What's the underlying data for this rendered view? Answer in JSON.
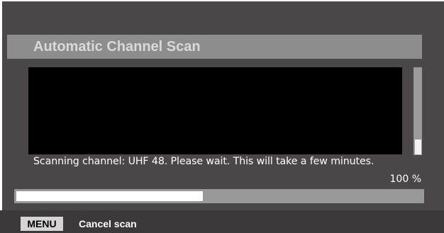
{
  "dialog": {
    "title": "Automatic Channel Scan",
    "status_message": "Scanning channel: UHF 48. Please wait. This will take a few minutes.",
    "progress_label": "100 %",
    "progress_fraction": 0.46,
    "scroll_position": 1.0
  },
  "footer": {
    "key_label": "MENU",
    "action_label": "Cancel scan"
  },
  "colors": {
    "background": "#4a4748",
    "title_bar": "#8e8d8e",
    "title_text": "#d9d9d9",
    "scan_window": "#000000",
    "progress_track": "#9a999a",
    "progress_fill": "#ffffff",
    "footer_bar": "#3b393a",
    "key_background": "#d4d4d4"
  }
}
